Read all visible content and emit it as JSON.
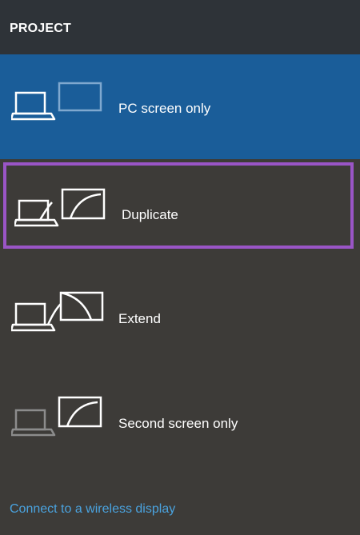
{
  "header": {
    "title": "PROJECT"
  },
  "options": [
    {
      "label": "PC screen only",
      "icon": "pc-screen-only-icon",
      "state": "selected"
    },
    {
      "label": "Duplicate",
      "icon": "duplicate-icon",
      "state": "highlighted"
    },
    {
      "label": "Extend",
      "icon": "extend-icon",
      "state": "normal"
    },
    {
      "label": "Second screen only",
      "icon": "second-screen-only-icon",
      "state": "normal"
    }
  ],
  "footer": {
    "wireless_link": "Connect to a wireless display"
  },
  "colors": {
    "panel_background": "#3d3b38",
    "header_background": "#2e3338",
    "selected_background": "#1a5d99",
    "highlight_border": "#9a55c6",
    "link": "#4aa3df"
  }
}
